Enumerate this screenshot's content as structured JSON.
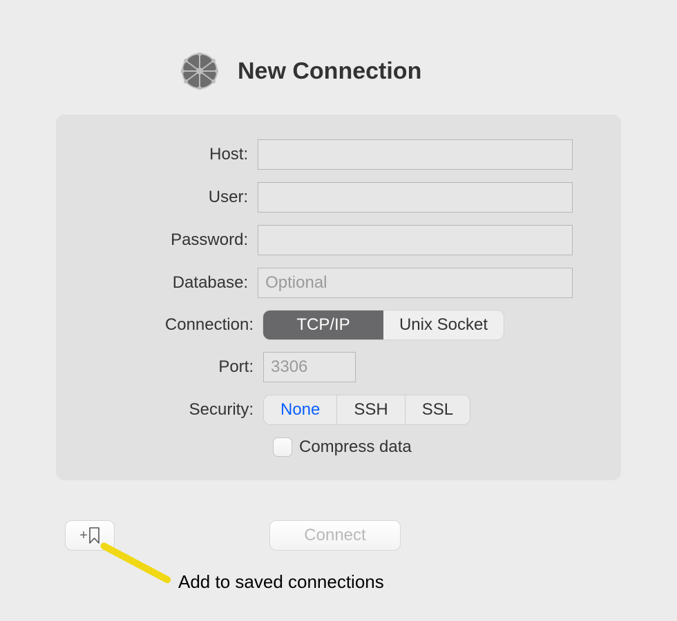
{
  "header": {
    "title": "New Connection"
  },
  "form": {
    "host_label": "Host:",
    "host_value": "",
    "user_label": "User:",
    "user_value": "",
    "password_label": "Password:",
    "password_value": "",
    "database_label": "Database:",
    "database_value": "",
    "database_placeholder": "Optional",
    "connection_label": "Connection:",
    "connection_options": {
      "tcpip": "TCP/IP",
      "unix": "Unix Socket"
    },
    "connection_selected": "tcpip",
    "port_label": "Port:",
    "port_value": "",
    "port_placeholder": "3306",
    "security_label": "Security:",
    "security_options": {
      "none": "None",
      "ssh": "SSH",
      "ssl": "SSL"
    },
    "security_selected": "none",
    "compress_label": "Compress data",
    "compress_checked": false
  },
  "footer": {
    "connect_label": "Connect",
    "callout_label": "Add to saved connections"
  }
}
